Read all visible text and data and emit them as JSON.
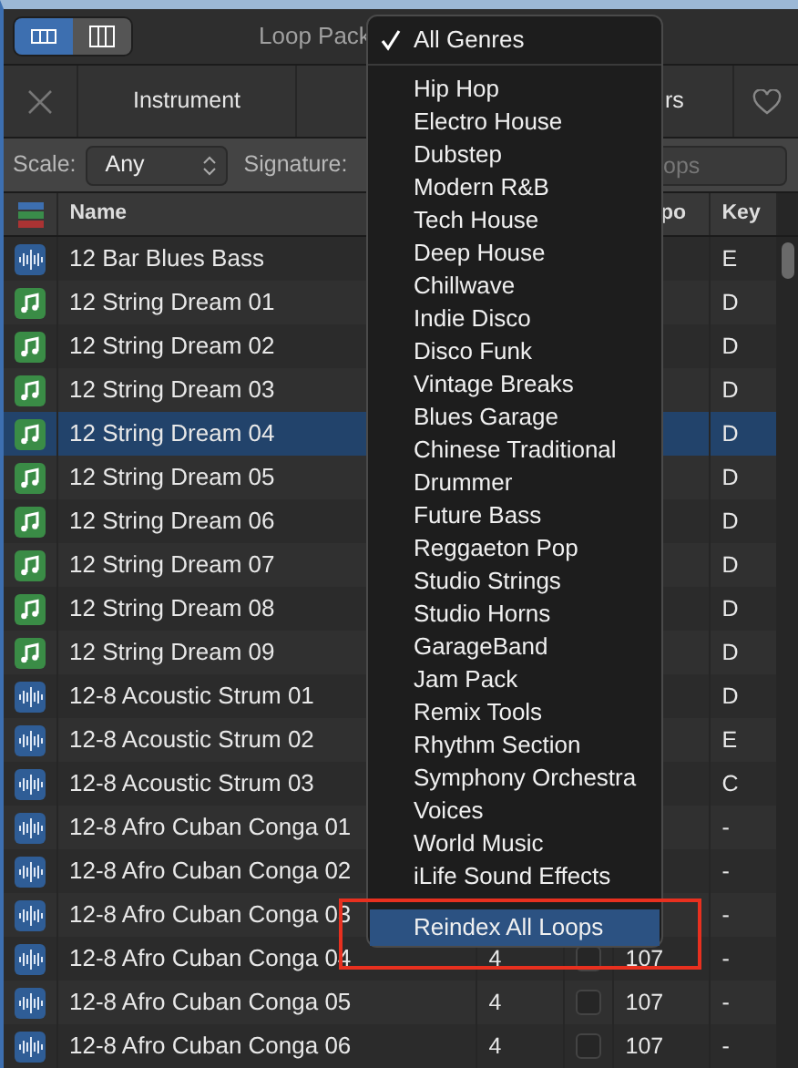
{
  "window": {
    "title": "Loop Pack",
    "view_toggle": [
      {
        "kind": "list",
        "selected": true
      },
      {
        "kind": "columns",
        "selected": false
      }
    ]
  },
  "toolbar": {
    "buttons": [
      {
        "kind": "close"
      },
      {
        "kind": "text",
        "label": "Instrument"
      },
      {
        "kind": "text",
        "label": "rs"
      },
      {
        "kind": "favorite"
      }
    ]
  },
  "filters": {
    "scale_label": "Scale:",
    "scale_value": "Any",
    "signature_label": "Signature:",
    "search": {
      "placeholder": "ops"
    }
  },
  "table": {
    "columns": [
      "Name",
      "po",
      "Key"
    ],
    "rows": [
      {
        "kind": "audio",
        "name": "12 Bar Blues Bass",
        "key": "E",
        "selected": false
      },
      {
        "kind": "midi",
        "name": "12 String Dream 01",
        "key": "D",
        "selected": false
      },
      {
        "kind": "midi",
        "name": "12 String Dream 02",
        "key": "D",
        "selected": false
      },
      {
        "kind": "midi",
        "name": "12 String Dream 03",
        "key": "D",
        "selected": false
      },
      {
        "kind": "midi",
        "name": "12 String Dream 04",
        "key": "D",
        "selected": true
      },
      {
        "kind": "midi",
        "name": "12 String Dream 05",
        "key": "D",
        "selected": false
      },
      {
        "kind": "midi",
        "name": "12 String Dream 06",
        "key": "D",
        "selected": false
      },
      {
        "kind": "midi",
        "name": "12 String Dream 07",
        "key": "D",
        "selected": false
      },
      {
        "kind": "midi",
        "name": "12 String Dream 08",
        "key": "D",
        "selected": false
      },
      {
        "kind": "midi",
        "name": "12 String Dream 09",
        "key": "D",
        "selected": false
      },
      {
        "kind": "audio",
        "name": "12-8 Acoustic Strum 01",
        "key": "D",
        "selected": false
      },
      {
        "kind": "audio",
        "name": "12-8 Acoustic Strum 02",
        "key": "E",
        "selected": false
      },
      {
        "kind": "audio",
        "name": "12-8 Acoustic Strum 03",
        "key": "C",
        "selected": false
      },
      {
        "kind": "audio",
        "name": "12-8 Afro Cuban Conga 01",
        "key": "-",
        "selected": false
      },
      {
        "kind": "audio",
        "name": "12-8 Afro Cuban Conga 02",
        "key": "-",
        "selected": false
      },
      {
        "kind": "audio",
        "name": "12-8 Afro Cuban Conga 03",
        "key": "-",
        "selected": false
      },
      {
        "kind": "audio",
        "name": "12-8 Afro Cuban Conga 04",
        "beats": "4",
        "tempo": "107",
        "key": "-",
        "selected": false
      },
      {
        "kind": "audio",
        "name": "12-8 Afro Cuban Conga 05",
        "beats": "4",
        "tempo": "107",
        "key": "-",
        "selected": false
      },
      {
        "kind": "audio",
        "name": "12-8 Afro Cuban Conga 06",
        "beats": "4",
        "tempo": "107",
        "key": "-",
        "selected": false
      }
    ]
  },
  "menu": {
    "items": [
      {
        "kind": "option",
        "label": "All Genres",
        "checked": true,
        "highlighted": false
      },
      {
        "kind": "separator"
      },
      {
        "kind": "option",
        "label": "Hip Hop",
        "checked": false,
        "highlighted": false
      },
      {
        "kind": "option",
        "label": "Electro House",
        "checked": false,
        "highlighted": false
      },
      {
        "kind": "option",
        "label": "Dubstep",
        "checked": false,
        "highlighted": false
      },
      {
        "kind": "option",
        "label": "Modern R&B",
        "checked": false,
        "highlighted": false
      },
      {
        "kind": "option",
        "label": "Tech House",
        "checked": false,
        "highlighted": false
      },
      {
        "kind": "option",
        "label": "Deep House",
        "checked": false,
        "highlighted": false
      },
      {
        "kind": "option",
        "label": "Chillwave",
        "checked": false,
        "highlighted": false
      },
      {
        "kind": "option",
        "label": "Indie Disco",
        "checked": false,
        "highlighted": false
      },
      {
        "kind": "option",
        "label": "Disco Funk",
        "checked": false,
        "highlighted": false
      },
      {
        "kind": "option",
        "label": "Vintage Breaks",
        "checked": false,
        "highlighted": false
      },
      {
        "kind": "option",
        "label": "Blues Garage",
        "checked": false,
        "highlighted": false
      },
      {
        "kind": "option",
        "label": "Chinese Traditional",
        "checked": false,
        "highlighted": false
      },
      {
        "kind": "option",
        "label": "Drummer",
        "checked": false,
        "highlighted": false
      },
      {
        "kind": "option",
        "label": "Future Bass",
        "checked": false,
        "highlighted": false
      },
      {
        "kind": "option",
        "label": "Reggaeton Pop",
        "checked": false,
        "highlighted": false
      },
      {
        "kind": "option",
        "label": "Studio Strings",
        "checked": false,
        "highlighted": false
      },
      {
        "kind": "option",
        "label": "Studio Horns",
        "checked": false,
        "highlighted": false
      },
      {
        "kind": "option",
        "label": "GarageBand",
        "checked": false,
        "highlighted": false
      },
      {
        "kind": "option",
        "label": "Jam Pack",
        "checked": false,
        "highlighted": false
      },
      {
        "kind": "option",
        "label": "Remix Tools",
        "checked": false,
        "highlighted": false
      },
      {
        "kind": "option",
        "label": "Rhythm Section",
        "checked": false,
        "highlighted": false
      },
      {
        "kind": "option",
        "label": "Symphony Orchestra",
        "checked": false,
        "highlighted": false
      },
      {
        "kind": "option",
        "label": "Voices",
        "checked": false,
        "highlighted": false
      },
      {
        "kind": "option",
        "label": "World Music",
        "checked": false,
        "highlighted": false
      },
      {
        "kind": "option",
        "label": "iLife Sound Effects",
        "checked": false,
        "highlighted": false
      },
      {
        "kind": "separator"
      },
      {
        "kind": "option",
        "label": "Reindex All Loops",
        "checked": false,
        "highlighted": true,
        "outlined": true
      }
    ]
  }
}
